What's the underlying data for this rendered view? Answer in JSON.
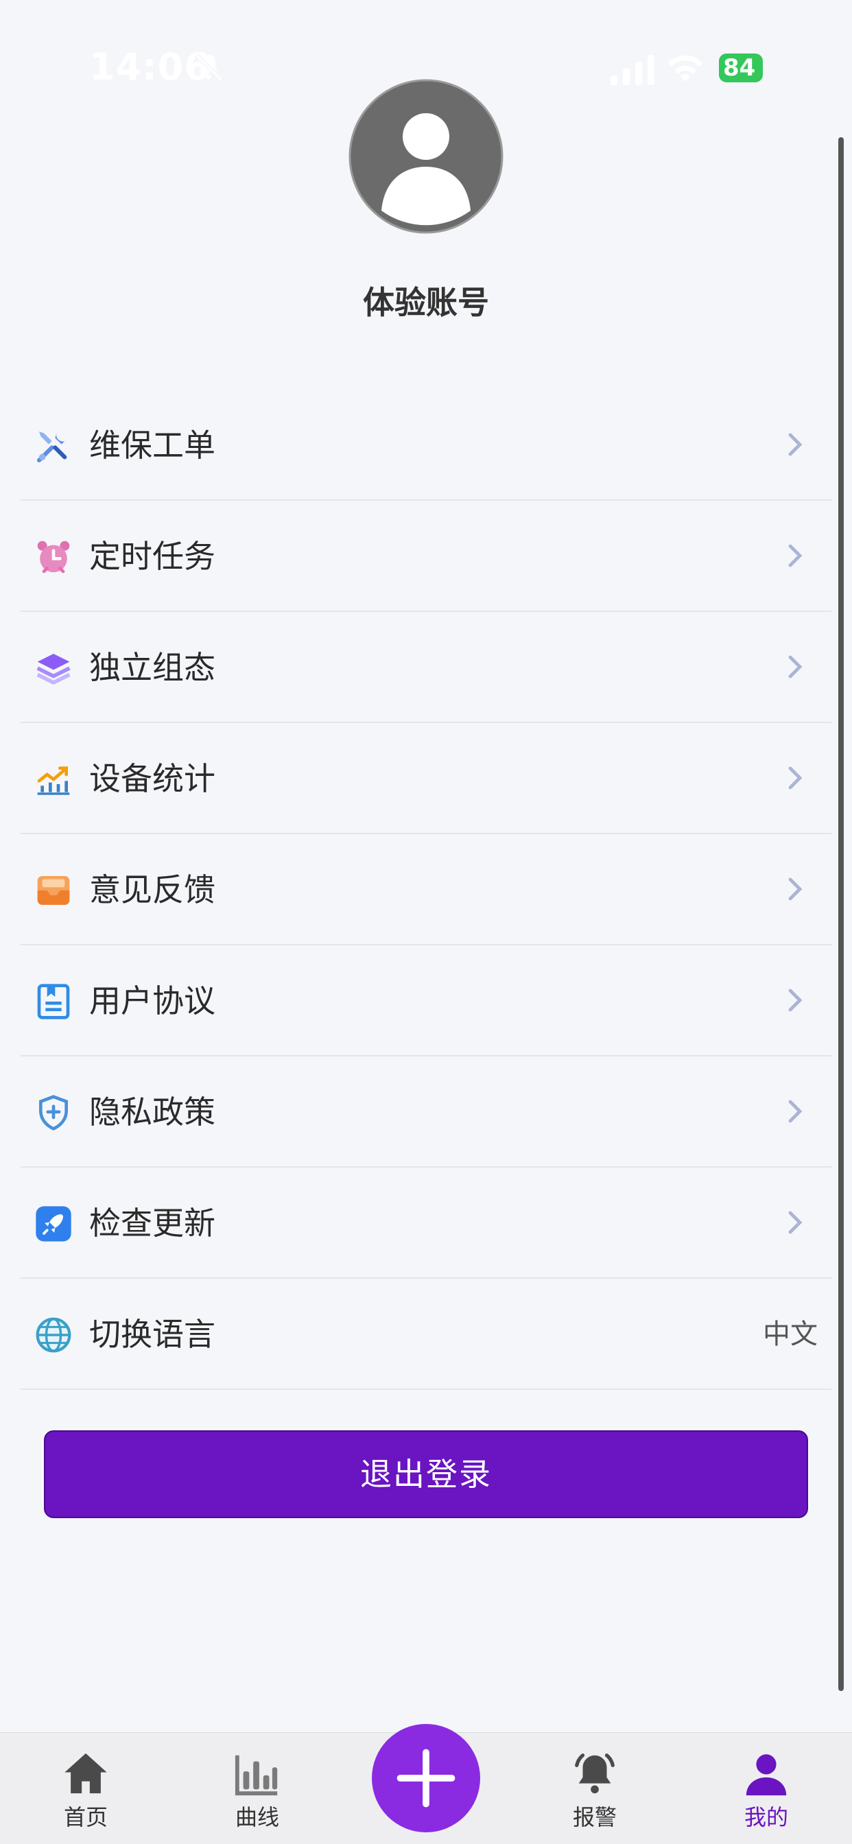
{
  "status_bar": {
    "time": "14:06",
    "battery": "84"
  },
  "profile": {
    "account_name": "体验账号"
  },
  "menu": {
    "items": [
      {
        "label": "维保工单",
        "icon": "wrench-screwdriver-icon"
      },
      {
        "label": "定时任务",
        "icon": "alarm-clock-icon"
      },
      {
        "label": "独立组态",
        "icon": "layers-icon"
      },
      {
        "label": "设备统计",
        "icon": "chart-trend-icon"
      },
      {
        "label": "意见反馈",
        "icon": "mail-inbox-icon"
      },
      {
        "label": "用户协议",
        "icon": "document-icon"
      },
      {
        "label": "隐私政策",
        "icon": "shield-icon"
      },
      {
        "label": "检查更新",
        "icon": "rocket-icon"
      },
      {
        "label": "切换语言",
        "icon": "globe-icon",
        "value": "中文"
      }
    ]
  },
  "logout_label": "退出登录",
  "tab_bar": {
    "tabs": [
      {
        "label": "首页",
        "icon": "home-icon"
      },
      {
        "label": "曲线",
        "icon": "bar-chart-icon"
      },
      {
        "label": "报警",
        "icon": "bell-icon"
      },
      {
        "label": "我的",
        "icon": "user-icon",
        "active": true
      }
    ],
    "add_icon": "plus-icon"
  },
  "colors": {
    "accent": "#6a14c2",
    "add_button": "#8a2be2",
    "background": "#f5f6fa",
    "chevron": "#aab4d4"
  }
}
